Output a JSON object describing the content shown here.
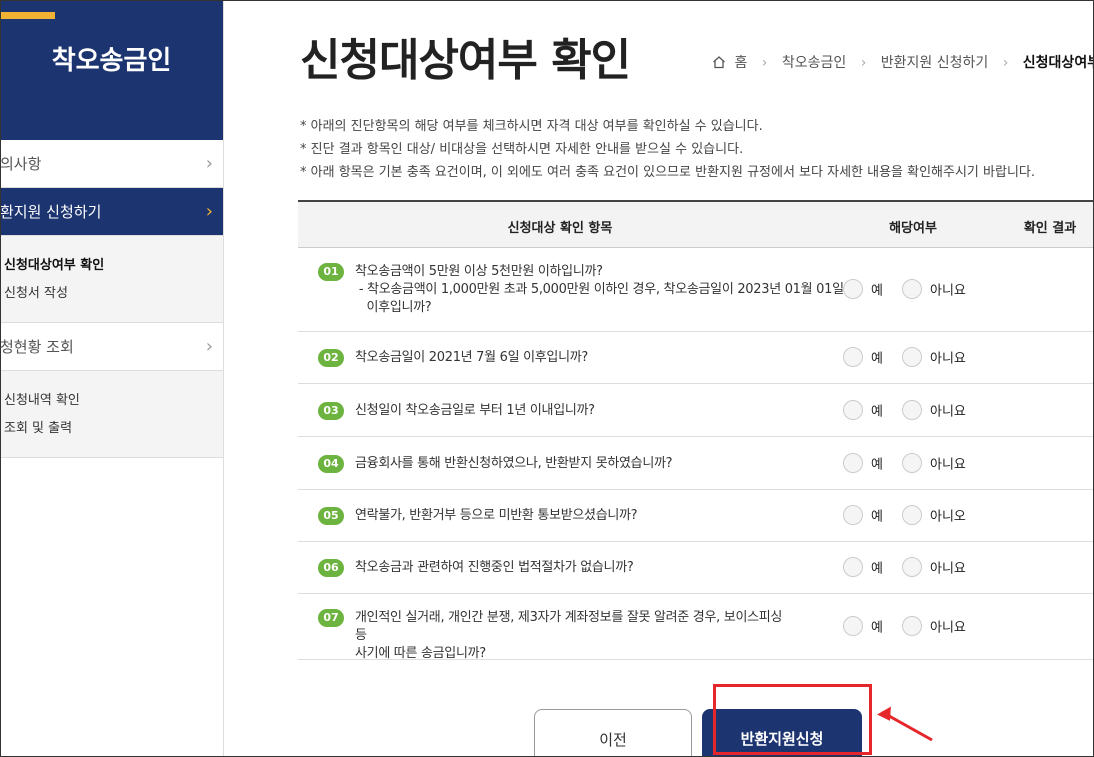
{
  "sidebar": {
    "title": "착오송금인",
    "items": [
      {
        "label": "의사항",
        "active": false
      },
      {
        "label": "환지원 신청하기",
        "active": true
      },
      {
        "label": "청현황 조회",
        "active": false
      }
    ],
    "submenu1": [
      "신청대상여부 확인",
      "신청서 작성"
    ],
    "submenu2": [
      "신청내역 확인",
      "조회 및 출력"
    ]
  },
  "page": {
    "title": "신청대상여부 확인",
    "breadcrumb": [
      "홈",
      "착오송금인",
      "반환지원 신청하기",
      "신청대상여부 확인"
    ]
  },
  "notes": [
    "아래의 진단항목의 해당 여부를 체크하시면 자격 대상 여부를 확인하실 수 있습니다.",
    "진단 결과 항목인 대상/ 비대상을 선택하시면 자세한 안내를 받으실 수 있습니다.",
    "아래 항목은 기본 충족 요건이며, 이 외에도 여러 충족 요건이 있으므로 반환지원 규정에서 보다 자세한 내용을 확인해주시기 바랍니다."
  ],
  "table": {
    "headers": [
      "신청대상 확인 항목",
      "해당여부",
      "확인 결과"
    ],
    "rows": [
      {
        "num": "01",
        "lines": [
          "착오송금액이 5만원 이상 5천만원 이하입니까?",
          " - 착오송금액이 1,000만원 초과 5,000만원 이하인 경우, 착오송금일이 2023년 01월 01일",
          "   이후입니까?"
        ],
        "yes": "예",
        "no": "아니요"
      },
      {
        "num": "02",
        "lines": [
          "착오송금일이 2021년 7월 6일 이후입니까?"
        ],
        "yes": "예",
        "no": "아니요"
      },
      {
        "num": "03",
        "lines": [
          "신청일이 착오송금일로 부터 1년 이내입니까?"
        ],
        "yes": "예",
        "no": "아니요"
      },
      {
        "num": "04",
        "lines": [
          "금융회사를 통해 반환신청하였으나, 반환받지 못하였습니까?"
        ],
        "yes": "예",
        "no": "아니요"
      },
      {
        "num": "05",
        "lines": [
          "연락불가, 반환거부 등으로 미반환 통보받으셨습니까?"
        ],
        "yes": "예",
        "no": "아니오"
      },
      {
        "num": "06",
        "lines": [
          "착오송금과 관련하여 진행중인 법적절차가 없습니까?"
        ],
        "yes": "예",
        "no": "아니요"
      },
      {
        "num": "07",
        "lines": [
          "개인적인 실거래, 개인간 분쟁, 제3자가 계좌정보를 잘못 알려준 경우, 보이스피싱 등",
          "사기에 따른 송금입니까?"
        ],
        "yes": "예",
        "no": "아니요"
      }
    ]
  },
  "buttons": {
    "prev": "이전",
    "apply": "반환지원신청"
  },
  "colors": {
    "navy": "#1c3470",
    "accent": "#f2b233",
    "badge": "#6db33f",
    "highlight": "#e5262b"
  }
}
